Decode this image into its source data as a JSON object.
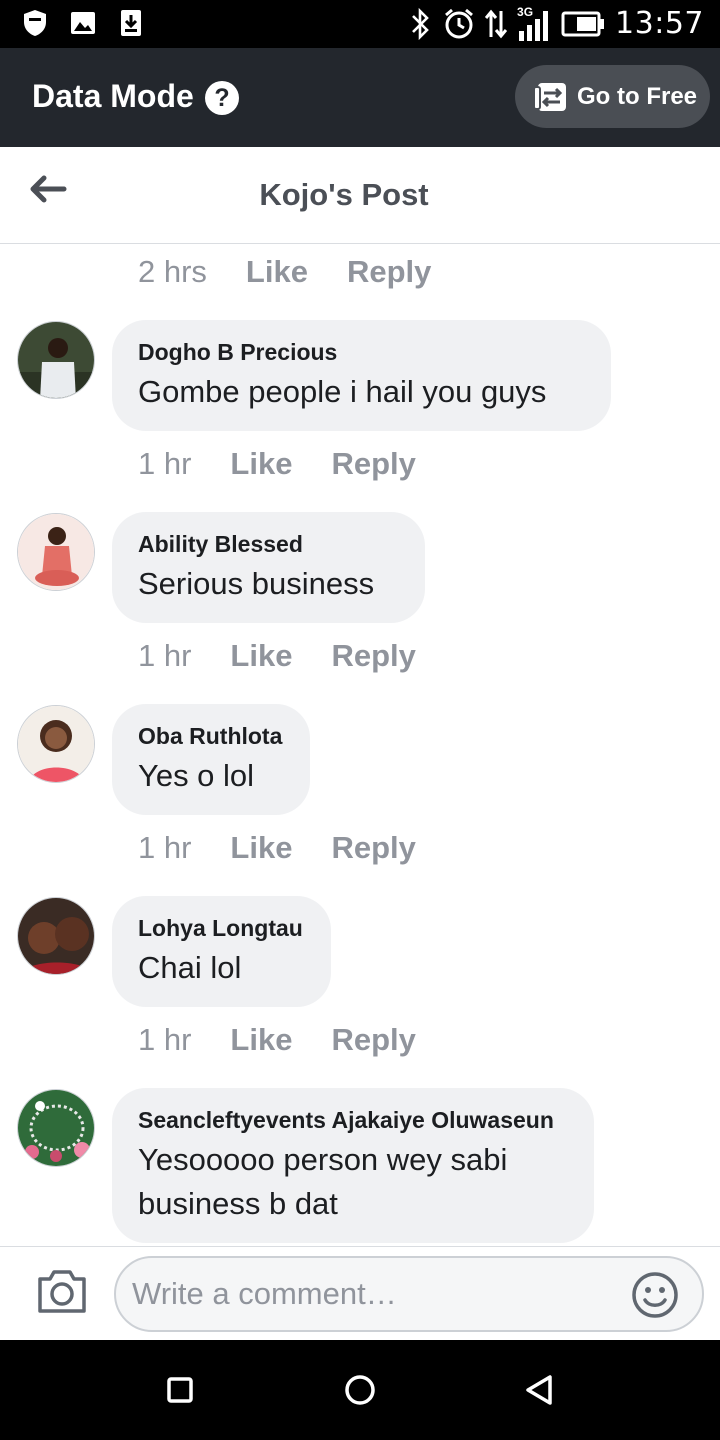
{
  "status_bar": {
    "time": "13:57",
    "network": "3G",
    "left_icons": [
      "shield-icon",
      "image-icon",
      "download-icon"
    ],
    "right_icons": [
      "bluetooth-icon",
      "alarm-icon",
      "data-arrows-icon",
      "signal-icon",
      "battery-icon"
    ]
  },
  "data_mode": {
    "title": "Data Mode",
    "help_glyph": "?",
    "go_free_label": "Go to Free"
  },
  "header": {
    "title": "Kojo's Post"
  },
  "top_meta": {
    "time": "2 hrs",
    "like": "Like",
    "reply": "Reply"
  },
  "comments": [
    {
      "author": "Dogho B Precious",
      "text": "Gombe people i hail  you guys",
      "time": "1 hr",
      "like": "Like",
      "reply": "Reply"
    },
    {
      "author": "Ability Blessed",
      "text": "Serious business",
      "time": "1 hr",
      "like": "Like",
      "reply": "Reply"
    },
    {
      "author": "Oba Ruthlota",
      "text": "Yes o lol",
      "time": "1 hr",
      "like": "Like",
      "reply": "Reply"
    },
    {
      "author": "Lohya Longtau",
      "text": "Chai lol",
      "time": "1 hr",
      "like": "Like",
      "reply": "Reply"
    },
    {
      "author": "Seancleftyevents Ajakaiye Oluwaseun",
      "text": "Yesooooo person wey sabi business b dat"
    }
  ],
  "composer": {
    "placeholder": "Write a comment…"
  },
  "colors": {
    "data_bar": "#23272d",
    "bubble": "#f0f1f3",
    "meta_text": "#90949c",
    "title_text": "#4b4f56"
  }
}
